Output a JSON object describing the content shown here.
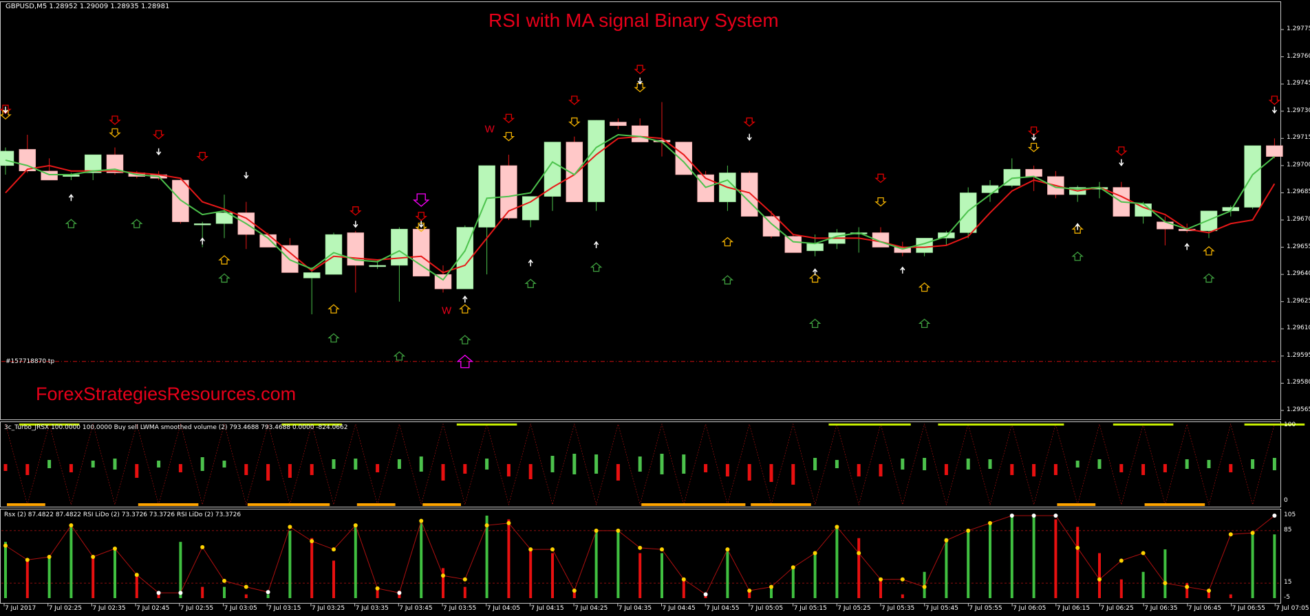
{
  "main": {
    "symbol_info": "GBPUSD,M5  1.28952 1.29009 1.28935 1.28981",
    "title": "RSI with MA signal Binary System",
    "brand": "ForexStrategiesResources.com",
    "order_label": "#157718870 tp",
    "price_axis": [
      "1.29775",
      "1.29760",
      "1.29745",
      "1.29730",
      "1.29715",
      "1.29700",
      "1.29685",
      "1.29670",
      "1.29655",
      "1.29640",
      "1.29625",
      "1.29610",
      "1.29595",
      "1.29580",
      "1.29565"
    ]
  },
  "indicator1": {
    "label": "3c_Turbo_JRSX 100.0000 100.0000  Buy sell LWMA smoothed volume (2) 793.4688 793.4688 0.0000 -824.0662",
    "scale": [
      "100",
      "0"
    ]
  },
  "indicator2": {
    "label": "Rsx (2) 87.4822 87.4822  RSI LiDo (2) 73.3726 73.3726  RSI LiDo (2) 73.3726",
    "scale": [
      "105",
      "85",
      "15",
      "-5"
    ]
  },
  "time_axis": [
    "7 Jul 2017",
    "7 Jul 02:25",
    "7 Jul 02:35",
    "7 Jul 02:45",
    "7 Jul 02:55",
    "7 Jul 03:05",
    "7 Jul 03:15",
    "7 Jul 03:25",
    "7 Jul 03:35",
    "7 Jul 03:45",
    "7 Jul 03:55",
    "7 Jul 04:05",
    "7 Jul 04:15",
    "7 Jul 04:25",
    "7 Jul 04:35",
    "7 Jul 04:45",
    "7 Jul 04:55",
    "7 Jul 05:05",
    "7 Jul 05:15",
    "7 Jul 05:25",
    "7 Jul 05:35",
    "7 Jul 05:45",
    "7 Jul 05:55",
    "7 Jul 06:05",
    "7 Jul 06:15",
    "7 Jul 06:25",
    "7 Jul 06:35",
    "7 Jul 06:45",
    "7 Jul 06:55",
    "7 Jul 07:05"
  ],
  "colors": {
    "bull": "#b8f7b8",
    "bear": "#ffc8c8",
    "ma_green": "#4cc24c",
    "ma_red": "#e81818",
    "title_red": "#e8001a",
    "up_green": "#3fa03f",
    "up_gold": "#f0b000",
    "down_red": "#e00000",
    "magenta": "#ff00ff",
    "orange": "#ffa500",
    "lime": "#c8f000"
  },
  "chart_data": {
    "type": "candlestick",
    "symbol": "GBPUSD",
    "timeframe": "M5",
    "ylim": [
      1.29565,
      1.29775
    ],
    "candles": [
      [
        1.297,
        1.2971,
        1.29695,
        1.29708
      ],
      [
        1.29709,
        1.29717,
        1.29696,
        1.29697
      ],
      [
        1.29697,
        1.29704,
        1.29692,
        1.29692
      ],
      [
        1.29694,
        1.29696,
        1.29692,
        1.29695
      ],
      [
        1.29696,
        1.29706,
        1.29692,
        1.29706
      ],
      [
        1.29706,
        1.2971,
        1.29695,
        1.29696
      ],
      [
        1.29696,
        1.29697,
        1.29693,
        1.29694
      ],
      [
        1.29695,
        1.29697,
        1.29692,
        1.29693
      ],
      [
        1.29692,
        1.29693,
        1.29668,
        1.29669
      ],
      [
        1.29668,
        1.29669,
        1.29655,
        1.29668
      ],
      [
        1.29668,
        1.29684,
        1.2966,
        1.29674
      ],
      [
        1.29674,
        1.2968,
        1.29654,
        1.29662
      ],
      [
        1.29662,
        1.29663,
        1.29655,
        1.29655
      ],
      [
        1.29656,
        1.2966,
        1.29641,
        1.29641
      ],
      [
        1.29638,
        1.29644,
        1.29618,
        1.29641
      ],
      [
        1.2964,
        1.29663,
        1.2964,
        1.29662
      ],
      [
        1.29663,
        1.29664,
        1.2963,
        1.29645
      ],
      [
        1.29645,
        1.29648,
        1.29643,
        1.29645
      ],
      [
        1.29645,
        1.29666,
        1.29625,
        1.29665
      ],
      [
        1.29665,
        1.29665,
        1.29639,
        1.29639
      ],
      [
        1.2964,
        1.29645,
        1.2963,
        1.29632
      ],
      [
        1.29632,
        1.29667,
        1.29632,
        1.29666
      ],
      [
        1.29666,
        1.297,
        1.2964,
        1.297
      ],
      [
        1.297,
        1.29706,
        1.2967,
        1.29671
      ],
      [
        1.2967,
        1.29683,
        1.29666,
        1.29683
      ],
      [
        1.29683,
        1.29713,
        1.29675,
        1.29713
      ],
      [
        1.29713,
        1.29716,
        1.2968,
        1.2968
      ],
      [
        1.2968,
        1.29725,
        1.29675,
        1.29725
      ],
      [
        1.29724,
        1.29726,
        1.2972,
        1.29722
      ],
      [
        1.29722,
        1.29726,
        1.2972,
        1.29713
      ],
      [
        1.29714,
        1.29735,
        1.29705,
        1.29713
      ],
      [
        1.29713,
        1.29713,
        1.29695,
        1.29695
      ],
      [
        1.29695,
        1.29697,
        1.2968,
        1.2968
      ],
      [
        1.2968,
        1.297,
        1.29675,
        1.29696
      ],
      [
        1.29696,
        1.29697,
        1.29672,
        1.29672
      ],
      [
        1.29672,
        1.29675,
        1.2966,
        1.29661
      ],
      [
        1.29661,
        1.29662,
        1.29652,
        1.29652
      ],
      [
        1.29653,
        1.29662,
        1.2965,
        1.29657
      ],
      [
        1.29657,
        1.29665,
        1.29654,
        1.29663
      ],
      [
        1.29663,
        1.29666,
        1.29652,
        1.29663
      ],
      [
        1.29663,
        1.29666,
        1.29655,
        1.29655
      ],
      [
        1.29655,
        1.29658,
        1.2965,
        1.29652
      ],
      [
        1.29652,
        1.2966,
        1.2965,
        1.2966
      ],
      [
        1.2966,
        1.29664,
        1.29656,
        1.29663
      ],
      [
        1.29663,
        1.29688,
        1.2966,
        1.29685
      ],
      [
        1.29685,
        1.29692,
        1.2968,
        1.29689
      ],
      [
        1.29689,
        1.29704,
        1.29688,
        1.29698
      ],
      [
        1.29698,
        1.297,
        1.29686,
        1.29694
      ],
      [
        1.29694,
        1.29697,
        1.29682,
        1.29684
      ],
      [
        1.29684,
        1.29689,
        1.2968,
        1.29688
      ],
      [
        1.29687,
        1.29691,
        1.29682,
        1.29688
      ],
      [
        1.29688,
        1.29691,
        1.29672,
        1.29672
      ],
      [
        1.29672,
        1.2968,
        1.29668,
        1.29679
      ],
      [
        1.29669,
        1.29672,
        1.29656,
        1.29665
      ],
      [
        1.29665,
        1.29668,
        1.29663,
        1.29664
      ],
      [
        1.29664,
        1.29675,
        1.2966,
        1.29675
      ],
      [
        1.29675,
        1.29678,
        1.29672,
        1.29677
      ],
      [
        1.29677,
        1.29711,
        1.29676,
        1.29711
      ],
      [
        1.29711,
        1.29715,
        1.29704,
        1.29705
      ]
    ],
    "ma_green": [
      1.29703,
      1.297,
      1.29695,
      1.29695,
      1.29697,
      1.29698,
      1.29695,
      1.29694,
      1.29681,
      1.29673,
      1.29675,
      1.29668,
      1.2966,
      1.29648,
      1.29643,
      1.29652,
      1.29648,
      1.29647,
      1.29653,
      1.29645,
      1.29637,
      1.29653,
      1.29682,
      1.29683,
      1.29685,
      1.29702,
      1.29695,
      1.2971,
      1.29717,
      1.29716,
      1.29713,
      1.29702,
      1.29688,
      1.29692,
      1.2968,
      1.29668,
      1.29658,
      1.29657,
      1.29661,
      1.29663,
      1.29658,
      1.29654,
      1.29657,
      1.29661,
      1.29675,
      1.29684,
      1.29693,
      1.29694,
      1.29688,
      1.29687,
      1.29688,
      1.2968,
      1.29679,
      1.29669,
      1.29665,
      1.2967,
      1.29675,
      1.29695,
      1.29705
    ],
    "ma_red": [
      1.29685,
      1.29698,
      1.297,
      1.29697,
      1.29697,
      1.29697,
      1.29696,
      1.29695,
      1.29693,
      1.2968,
      1.29676,
      1.29671,
      1.29662,
      1.29652,
      1.29642,
      1.2965,
      1.29649,
      1.29648,
      1.29649,
      1.2965,
      1.29641,
      1.29645,
      1.2966,
      1.29675,
      1.2968,
      1.29688,
      1.29695,
      1.29706,
      1.29715,
      1.29716,
      1.29715,
      1.29706,
      1.29693,
      1.29688,
      1.29685,
      1.29674,
      1.29662,
      1.2966,
      1.2966,
      1.2966,
      1.29658,
      1.29655,
      1.29655,
      1.29656,
      1.29661,
      1.29674,
      1.29686,
      1.29692,
      1.29689,
      1.29686,
      1.29688,
      1.29683,
      1.29677,
      1.29673,
      1.29665,
      1.29663,
      1.29668,
      1.2967,
      1.2969
    ],
    "order_line_price": 1.29592,
    "w_markers": [
      {
        "index": 22,
        "price": 1.29716,
        "color": "#e8001a"
      },
      {
        "index": 20,
        "price": 1.29625,
        "color": "#e8001a"
      }
    ],
    "indicator1_bars": [
      -25,
      -40,
      30,
      -30,
      25,
      40,
      -50,
      25,
      -30,
      50,
      25,
      -40,
      -60,
      -50,
      -40,
      35,
      40,
      -30,
      35,
      55,
      -60,
      -35,
      40,
      -45,
      -55,
      60,
      75,
      70,
      -60,
      55,
      75,
      70,
      -30,
      -45,
      -60,
      -65,
      -75,
      45,
      30,
      -45,
      -45,
      40,
      45,
      -40,
      40,
      35,
      -40,
      -45,
      -40,
      25,
      35,
      -30,
      -40,
      -30,
      35,
      30,
      -30,
      35,
      45
    ],
    "indicator2": {
      "rsx": [
        65,
        45,
        50,
        92,
        50,
        60,
        25,
        5,
        60,
        10,
        10,
        5,
        5,
        90,
        70,
        60,
        92,
        10,
        5,
        95,
        25,
        20,
        90,
        95,
        10,
        60,
        0,
        85,
        80,
        65,
        60,
        60,
        0,
        60,
        5,
        10,
        35,
        50,
        80,
        55,
        20,
        0,
        10,
        70,
        80,
        80,
        90,
        105,
        105,
        105,
        58,
        20,
        45,
        55,
        15,
        10,
        5,
        75,
        80,
        105,
        95
      ],
      "lido_vals": [
        70,
        45,
        50,
        90,
        50,
        60,
        25,
        0,
        70,
        10,
        10,
        0,
        0,
        85,
        75,
        45,
        90,
        10,
        5,
        100,
        35,
        10,
        105,
        100,
        60,
        55,
        5,
        85,
        85,
        55,
        55,
        20,
        0,
        60,
        5,
        10,
        35,
        55,
        90,
        75,
        20,
        0,
        30,
        75,
        85,
        95,
        105,
        105,
        100,
        90,
        55,
        20,
        30,
        60,
        15,
        5,
        0,
        80,
        80,
        105,
        85
      ],
      "dots_y": [
        65,
        46,
        50,
        92,
        50,
        61,
        26,
        2,
        2,
        63,
        18,
        10,
        3,
        90,
        71,
        60,
        92,
        8,
        2,
        98,
        25,
        20,
        92,
        95,
        60,
        60,
        5,
        85,
        85,
        62,
        60,
        20,
        0,
        60,
        5,
        10,
        36,
        55,
        90,
        55,
        20,
        20,
        10,
        72,
        85,
        95,
        105,
        105,
        105,
        62,
        20,
        45,
        55,
        15,
        10,
        5,
        80,
        82,
        105,
        88
      ]
    },
    "arrows": [
      {
        "i": 0,
        "dir": "down",
        "y": 1.29731,
        "c": "red"
      },
      {
        "i": 0,
        "dir": "down",
        "y": 1.29728,
        "c": "gold"
      },
      {
        "i": 5,
        "dir": "down",
        "y": 1.29725,
        "c": "red"
      },
      {
        "i": 5,
        "dir": "down",
        "y": 1.29718,
        "c": "gold"
      },
      {
        "i": 7,
        "dir": "down",
        "y": 1.29717,
        "c": "red"
      },
      {
        "i": 9,
        "dir": "down",
        "y": 1.29705,
        "c": "red"
      },
      {
        "i": 3,
        "dir": "up",
        "y": 1.29668,
        "c": "green"
      },
      {
        "i": 6,
        "dir": "up",
        "y": 1.29668,
        "c": "green"
      },
      {
        "i": 10,
        "dir": "up",
        "y": 1.29648,
        "c": "gold"
      },
      {
        "i": 10,
        "dir": "up",
        "y": 1.29638,
        "c": "green"
      },
      {
        "i": 15,
        "dir": "up",
        "y": 1.29621,
        "c": "gold"
      },
      {
        "i": 15,
        "dir": "up",
        "y": 1.29605,
        "c": "green"
      },
      {
        "i": 16,
        "dir": "down",
        "y": 1.29675,
        "c": "red"
      },
      {
        "i": 18,
        "dir": "up",
        "y": 1.29595,
        "c": "green"
      },
      {
        "i": 19,
        "dir": "down",
        "y": 1.29681,
        "c": "magenta"
      },
      {
        "i": 19,
        "dir": "down",
        "y": 1.29672,
        "c": "red"
      },
      {
        "i": 19,
        "dir": "down",
        "y": 1.29666,
        "c": "gold"
      },
      {
        "i": 21,
        "dir": "up",
        "y": 1.29621,
        "c": "gold"
      },
      {
        "i": 21,
        "dir": "up",
        "y": 1.29604,
        "c": "green"
      },
      {
        "i": 21,
        "dir": "up",
        "y": 1.29592,
        "c": "magenta"
      },
      {
        "i": 23,
        "dir": "down",
        "y": 1.29726,
        "c": "red"
      },
      {
        "i": 23,
        "dir": "down",
        "y": 1.29716,
        "c": "gold"
      },
      {
        "i": 24,
        "dir": "up",
        "y": 1.29635,
        "c": "green"
      },
      {
        "i": 26,
        "dir": "down",
        "y": 1.29736,
        "c": "red"
      },
      {
        "i": 26,
        "dir": "down",
        "y": 1.29724,
        "c": "gold"
      },
      {
        "i": 27,
        "dir": "up",
        "y": 1.29644,
        "c": "green"
      },
      {
        "i": 29,
        "dir": "down",
        "y": 1.29753,
        "c": "red"
      },
      {
        "i": 29,
        "dir": "down",
        "y": 1.29743,
        "c": "gold"
      },
      {
        "i": 33,
        "dir": "up",
        "y": 1.29658,
        "c": "gold"
      },
      {
        "i": 33,
        "dir": "up",
        "y": 1.29637,
        "c": "green"
      },
      {
        "i": 34,
        "dir": "down",
        "y": 1.29724,
        "c": "red"
      },
      {
        "i": 37,
        "dir": "up",
        "y": 1.29638,
        "c": "gold"
      },
      {
        "i": 37,
        "dir": "up",
        "y": 1.29613,
        "c": "green"
      },
      {
        "i": 40,
        "dir": "down",
        "y": 1.29693,
        "c": "red"
      },
      {
        "i": 40,
        "dir": "down",
        "y": 1.2968,
        "c": "gold"
      },
      {
        "i": 42,
        "dir": "up",
        "y": 1.29633,
        "c": "gold"
      },
      {
        "i": 42,
        "dir": "up",
        "y": 1.29613,
        "c": "green"
      },
      {
        "i": 47,
        "dir": "down",
        "y": 1.29719,
        "c": "red"
      },
      {
        "i": 47,
        "dir": "down",
        "y": 1.2971,
        "c": "gold"
      },
      {
        "i": 49,
        "dir": "up",
        "y": 1.29665,
        "c": "gold"
      },
      {
        "i": 49,
        "dir": "up",
        "y": 1.2965,
        "c": "green"
      },
      {
        "i": 51,
        "dir": "down",
        "y": 1.29708,
        "c": "red"
      },
      {
        "i": 55,
        "dir": "up",
        "y": 1.29653,
        "c": "gold"
      },
      {
        "i": 55,
        "dir": "up",
        "y": 1.29638,
        "c": "green"
      },
      {
        "i": 58,
        "dir": "down",
        "y": 1.29736,
        "c": "red"
      }
    ],
    "white_arrows": [
      {
        "i": 0,
        "dir": "down",
        "y": 1.29731
      },
      {
        "i": 3,
        "dir": "up",
        "y": 1.29682
      },
      {
        "i": 7,
        "dir": "down",
        "y": 1.29708
      },
      {
        "i": 9,
        "dir": "up",
        "y": 1.29658
      },
      {
        "i": 11,
        "dir": "down",
        "y": 1.29695
      },
      {
        "i": 16,
        "dir": "down",
        "y": 1.29668
      },
      {
        "i": 19,
        "dir": "down",
        "y": 1.29668
      },
      {
        "i": 21,
        "dir": "up",
        "y": 1.29626
      },
      {
        "i": 24,
        "dir": "up",
        "y": 1.29646
      },
      {
        "i": 27,
        "dir": "up",
        "y": 1.29656
      },
      {
        "i": 29,
        "dir": "down",
        "y": 1.29747
      },
      {
        "i": 34,
        "dir": "down",
        "y": 1.29716
      },
      {
        "i": 37,
        "dir": "up",
        "y": 1.29641
      },
      {
        "i": 41,
        "dir": "up",
        "y": 1.29642
      },
      {
        "i": 47,
        "dir": "down",
        "y": 1.29716
      },
      {
        "i": 49,
        "dir": "up",
        "y": 1.29666
      },
      {
        "i": 51,
        "dir": "down",
        "y": 1.29702
      },
      {
        "i": 54,
        "dir": "up",
        "y": 1.29655
      },
      {
        "i": 58,
        "dir": "down",
        "y": 1.29731
      }
    ]
  }
}
